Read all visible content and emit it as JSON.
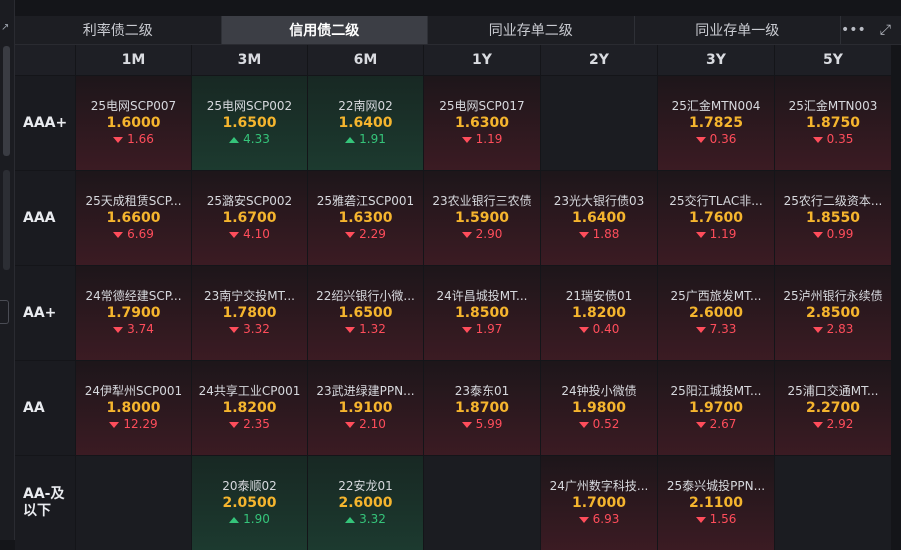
{
  "tabs": [
    {
      "label": "利率债二级",
      "active": false
    },
    {
      "label": "信用债二级",
      "active": true
    },
    {
      "label": "同业存单二级",
      "active": false
    },
    {
      "label": "同业存单一级",
      "active": false
    }
  ],
  "tools": {
    "more": "•••",
    "expand": "⤢",
    "corner": "↗"
  },
  "columns": [
    "1M",
    "3M",
    "6M",
    "1Y",
    "2Y",
    "3Y",
    "5Y"
  ],
  "rows": [
    {
      "label": "AAA+",
      "cells": [
        {
          "name": "25电网SCP007",
          "price": "1.6000",
          "change": "1.66",
          "dir": "down"
        },
        {
          "name": "25电网SCP002",
          "price": "1.6500",
          "change": "4.33",
          "dir": "up"
        },
        {
          "name": "22南网02",
          "price": "1.6400",
          "change": "1.91",
          "dir": "up"
        },
        {
          "name": "25电网SCP017",
          "price": "1.6300",
          "change": "1.19",
          "dir": "down"
        },
        null,
        {
          "name": "25汇金MTN004",
          "price": "1.7825",
          "change": "0.36",
          "dir": "down"
        },
        {
          "name": "25汇金MTN003",
          "price": "1.8750",
          "change": "0.35",
          "dir": "down"
        }
      ]
    },
    {
      "label": "AAA",
      "cells": [
        {
          "name": "25天成租赁SCP...",
          "price": "1.6600",
          "change": "6.69",
          "dir": "down"
        },
        {
          "name": "25潞安SCP002",
          "price": "1.6700",
          "change": "4.10",
          "dir": "down"
        },
        {
          "name": "25雅砻江SCP001",
          "price": "1.6300",
          "change": "2.29",
          "dir": "down"
        },
        {
          "name": "23农业银行三农债",
          "price": "1.5900",
          "change": "2.90",
          "dir": "down"
        },
        {
          "name": "23光大银行债03",
          "price": "1.6400",
          "change": "1.88",
          "dir": "down"
        },
        {
          "name": "25交行TLAC非...",
          "price": "1.7600",
          "change": "1.19",
          "dir": "down"
        },
        {
          "name": "25农行二级资本...",
          "price": "1.8550",
          "change": "0.99",
          "dir": "down"
        }
      ]
    },
    {
      "label": "AA+",
      "cells": [
        {
          "name": "24常德经建SCP...",
          "price": "1.7900",
          "change": "3.74",
          "dir": "down"
        },
        {
          "name": "23南宁交投MT...",
          "price": "1.7800",
          "change": "3.32",
          "dir": "down"
        },
        {
          "name": "22绍兴银行小微...",
          "price": "1.6500",
          "change": "1.32",
          "dir": "down"
        },
        {
          "name": "24许昌城投MT...",
          "price": "1.8500",
          "change": "1.97",
          "dir": "down"
        },
        {
          "name": "21瑞安债01",
          "price": "1.8200",
          "change": "0.40",
          "dir": "down"
        },
        {
          "name": "25广西旅发MT...",
          "price": "2.6000",
          "change": "7.33",
          "dir": "down"
        },
        {
          "name": "25泸州银行永续债",
          "price": "2.8500",
          "change": "2.83",
          "dir": "down"
        }
      ]
    },
    {
      "label": "AA",
      "cells": [
        {
          "name": "24伊犁州SCP001",
          "price": "1.8000",
          "change": "12.29",
          "dir": "down"
        },
        {
          "name": "24共享工业CP001",
          "price": "1.8200",
          "change": "2.35",
          "dir": "down"
        },
        {
          "name": "23武进绿建PPN...",
          "price": "1.9100",
          "change": "2.10",
          "dir": "down"
        },
        {
          "name": "23泰东01",
          "price": "1.8700",
          "change": "5.99",
          "dir": "down"
        },
        {
          "name": "24钟投小微债",
          "price": "1.9800",
          "change": "0.52",
          "dir": "down"
        },
        {
          "name": "25阳江城投MT...",
          "price": "1.9700",
          "change": "2.67",
          "dir": "down"
        },
        {
          "name": "25浦口交通MT...",
          "price": "2.2700",
          "change": "2.92",
          "dir": "down"
        }
      ]
    },
    {
      "label": "AA-及以下",
      "cells": [
        null,
        {
          "name": "20泰顺02",
          "price": "2.0500",
          "change": "1.90",
          "dir": "up"
        },
        {
          "name": "22安龙01",
          "price": "2.6000",
          "change": "3.32",
          "dir": "up"
        },
        null,
        {
          "name": "24广州数字科技...",
          "price": "1.7000",
          "change": "6.93",
          "dir": "down"
        },
        {
          "name": "25泰兴城投PPN...",
          "price": "2.1100",
          "change": "1.56",
          "dir": "down"
        },
        null
      ]
    }
  ],
  "colors": {
    "price": "#f5b52e",
    "down": "#ff4d5b",
    "up": "#35c47a",
    "active_tab": "#3c3e45"
  }
}
